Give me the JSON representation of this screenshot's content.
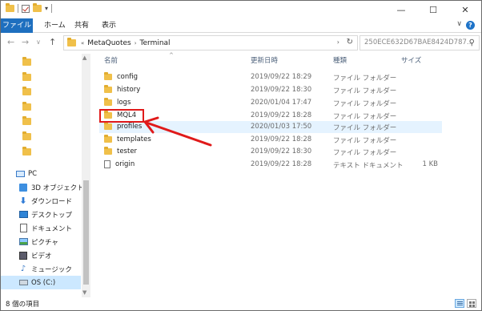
{
  "titlebar": {
    "qat_dropdown": "▾",
    "minimize": "—",
    "maximize": "☐",
    "close": "✕"
  },
  "ribbon": {
    "tabs": [
      "ファイル",
      "ホーム",
      "共有",
      "表示"
    ],
    "expand": "∨",
    "help": "?"
  },
  "address": {
    "back": "←",
    "forward": "→",
    "recent": "∨",
    "up": "↑",
    "overflow": "«",
    "crumbs": [
      "MetaQuotes",
      "Terminal"
    ],
    "separator": "›",
    "dropdown": "›",
    "refresh": "↻"
  },
  "search": {
    "placeholder": "250ECE632D67BAE8424D787...",
    "icon": "search-icon"
  },
  "nav": {
    "items": [
      {
        "label": "PC",
        "icon": "pc-icon"
      },
      {
        "label": "3D オブジェクト",
        "icon": "3d-objects-icon"
      },
      {
        "label": "ダウンロード",
        "icon": "download-icon"
      },
      {
        "label": "デスクトップ",
        "icon": "desktop-icon"
      },
      {
        "label": "ドキュメント",
        "icon": "document-icon"
      },
      {
        "label": "ピクチャ",
        "icon": "picture-icon"
      },
      {
        "label": "ビデオ",
        "icon": "video-icon"
      },
      {
        "label": "ミュージック",
        "icon": "music-icon"
      },
      {
        "label": "OS (C:)",
        "icon": "drive-icon"
      }
    ],
    "selected": "OS (C:)"
  },
  "columns": {
    "name": "名前",
    "date": "更新日時",
    "type": "種類",
    "size": "サイズ",
    "sort_indicator": "^"
  },
  "files": [
    {
      "name": "config",
      "date": "2019/09/22 18:29",
      "type": "ファイル フォルダー",
      "size": "",
      "icon": "folder-icon"
    },
    {
      "name": "history",
      "date": "2019/09/22 18:30",
      "type": "ファイル フォルダー",
      "size": "",
      "icon": "folder-icon"
    },
    {
      "name": "logs",
      "date": "2020/01/04 17:47",
      "type": "ファイル フォルダー",
      "size": "",
      "icon": "folder-icon"
    },
    {
      "name": "MQL4",
      "date": "2019/09/22 18:28",
      "type": "ファイル フォルダー",
      "size": "",
      "icon": "folder-icon"
    },
    {
      "name": "profiles",
      "date": "2020/01/03 17:50",
      "type": "ファイル フォルダー",
      "size": "",
      "icon": "folder-icon"
    },
    {
      "name": "templates",
      "date": "2019/09/22 18:28",
      "type": "ファイル フォルダー",
      "size": "",
      "icon": "folder-icon"
    },
    {
      "name": "tester",
      "date": "2019/09/22 18:30",
      "type": "ファイル フォルダー",
      "size": "",
      "icon": "folder-icon"
    },
    {
      "name": "origin",
      "date": "2019/09/22 18:28",
      "type": "テキスト ドキュメント",
      "size": "1 KB",
      "icon": "text-file-icon"
    }
  ],
  "highlighted_row": "profiles",
  "annotation": {
    "target": "MQL4",
    "color": "#e01a1a"
  },
  "status": {
    "item_count": "8 個の項目"
  },
  "colors": {
    "file_tab": "#1e6fbf",
    "selection": "#cce8ff",
    "hover_row": "#e5f3ff",
    "folder": "#f0c04a"
  }
}
